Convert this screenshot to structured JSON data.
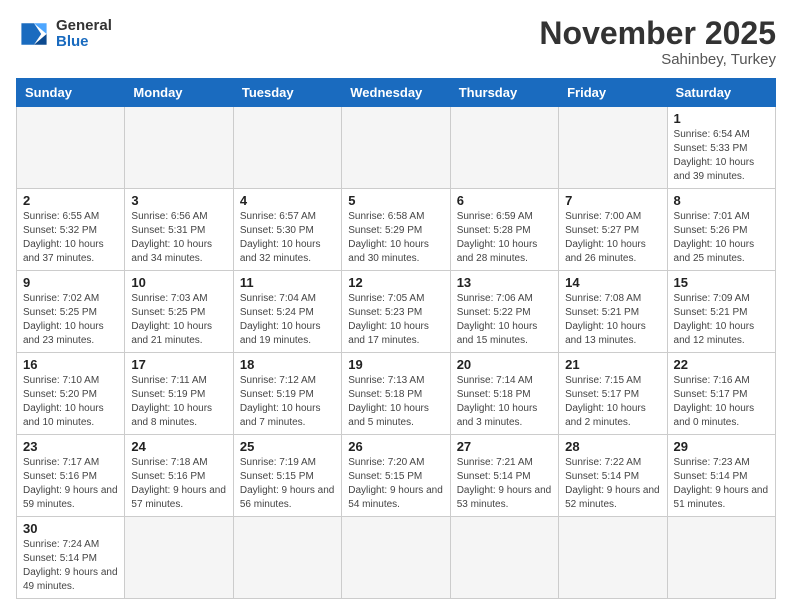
{
  "logo": {
    "text_general": "General",
    "text_blue": "Blue"
  },
  "header": {
    "month": "November 2025",
    "location": "Sahinbey, Turkey"
  },
  "days_of_week": [
    "Sunday",
    "Monday",
    "Tuesday",
    "Wednesday",
    "Thursday",
    "Friday",
    "Saturday"
  ],
  "weeks": [
    [
      {
        "day": "",
        "info": ""
      },
      {
        "day": "",
        "info": ""
      },
      {
        "day": "",
        "info": ""
      },
      {
        "day": "",
        "info": ""
      },
      {
        "day": "",
        "info": ""
      },
      {
        "day": "",
        "info": ""
      },
      {
        "day": "1",
        "info": "Sunrise: 6:54 AM\nSunset: 5:33 PM\nDaylight: 10 hours and 39 minutes."
      }
    ],
    [
      {
        "day": "2",
        "info": "Sunrise: 6:55 AM\nSunset: 5:32 PM\nDaylight: 10 hours and 37 minutes."
      },
      {
        "day": "3",
        "info": "Sunrise: 6:56 AM\nSunset: 5:31 PM\nDaylight: 10 hours and 34 minutes."
      },
      {
        "day": "4",
        "info": "Sunrise: 6:57 AM\nSunset: 5:30 PM\nDaylight: 10 hours and 32 minutes."
      },
      {
        "day": "5",
        "info": "Sunrise: 6:58 AM\nSunset: 5:29 PM\nDaylight: 10 hours and 30 minutes."
      },
      {
        "day": "6",
        "info": "Sunrise: 6:59 AM\nSunset: 5:28 PM\nDaylight: 10 hours and 28 minutes."
      },
      {
        "day": "7",
        "info": "Sunrise: 7:00 AM\nSunset: 5:27 PM\nDaylight: 10 hours and 26 minutes."
      },
      {
        "day": "8",
        "info": "Sunrise: 7:01 AM\nSunset: 5:26 PM\nDaylight: 10 hours and 25 minutes."
      }
    ],
    [
      {
        "day": "9",
        "info": "Sunrise: 7:02 AM\nSunset: 5:25 PM\nDaylight: 10 hours and 23 minutes."
      },
      {
        "day": "10",
        "info": "Sunrise: 7:03 AM\nSunset: 5:25 PM\nDaylight: 10 hours and 21 minutes."
      },
      {
        "day": "11",
        "info": "Sunrise: 7:04 AM\nSunset: 5:24 PM\nDaylight: 10 hours and 19 minutes."
      },
      {
        "day": "12",
        "info": "Sunrise: 7:05 AM\nSunset: 5:23 PM\nDaylight: 10 hours and 17 minutes."
      },
      {
        "day": "13",
        "info": "Sunrise: 7:06 AM\nSunset: 5:22 PM\nDaylight: 10 hours and 15 minutes."
      },
      {
        "day": "14",
        "info": "Sunrise: 7:08 AM\nSunset: 5:21 PM\nDaylight: 10 hours and 13 minutes."
      },
      {
        "day": "15",
        "info": "Sunrise: 7:09 AM\nSunset: 5:21 PM\nDaylight: 10 hours and 12 minutes."
      }
    ],
    [
      {
        "day": "16",
        "info": "Sunrise: 7:10 AM\nSunset: 5:20 PM\nDaylight: 10 hours and 10 minutes."
      },
      {
        "day": "17",
        "info": "Sunrise: 7:11 AM\nSunset: 5:19 PM\nDaylight: 10 hours and 8 minutes."
      },
      {
        "day": "18",
        "info": "Sunrise: 7:12 AM\nSunset: 5:19 PM\nDaylight: 10 hours and 7 minutes."
      },
      {
        "day": "19",
        "info": "Sunrise: 7:13 AM\nSunset: 5:18 PM\nDaylight: 10 hours and 5 minutes."
      },
      {
        "day": "20",
        "info": "Sunrise: 7:14 AM\nSunset: 5:18 PM\nDaylight: 10 hours and 3 minutes."
      },
      {
        "day": "21",
        "info": "Sunrise: 7:15 AM\nSunset: 5:17 PM\nDaylight: 10 hours and 2 minutes."
      },
      {
        "day": "22",
        "info": "Sunrise: 7:16 AM\nSunset: 5:17 PM\nDaylight: 10 hours and 0 minutes."
      }
    ],
    [
      {
        "day": "23",
        "info": "Sunrise: 7:17 AM\nSunset: 5:16 PM\nDaylight: 9 hours and 59 minutes."
      },
      {
        "day": "24",
        "info": "Sunrise: 7:18 AM\nSunset: 5:16 PM\nDaylight: 9 hours and 57 minutes."
      },
      {
        "day": "25",
        "info": "Sunrise: 7:19 AM\nSunset: 5:15 PM\nDaylight: 9 hours and 56 minutes."
      },
      {
        "day": "26",
        "info": "Sunrise: 7:20 AM\nSunset: 5:15 PM\nDaylight: 9 hours and 54 minutes."
      },
      {
        "day": "27",
        "info": "Sunrise: 7:21 AM\nSunset: 5:14 PM\nDaylight: 9 hours and 53 minutes."
      },
      {
        "day": "28",
        "info": "Sunrise: 7:22 AM\nSunset: 5:14 PM\nDaylight: 9 hours and 52 minutes."
      },
      {
        "day": "29",
        "info": "Sunrise: 7:23 AM\nSunset: 5:14 PM\nDaylight: 9 hours and 51 minutes."
      }
    ],
    [
      {
        "day": "30",
        "info": "Sunrise: 7:24 AM\nSunset: 5:14 PM\nDaylight: 9 hours and 49 minutes."
      },
      {
        "day": "",
        "info": ""
      },
      {
        "day": "",
        "info": ""
      },
      {
        "day": "",
        "info": ""
      },
      {
        "day": "",
        "info": ""
      },
      {
        "day": "",
        "info": ""
      },
      {
        "day": "",
        "info": ""
      }
    ]
  ]
}
